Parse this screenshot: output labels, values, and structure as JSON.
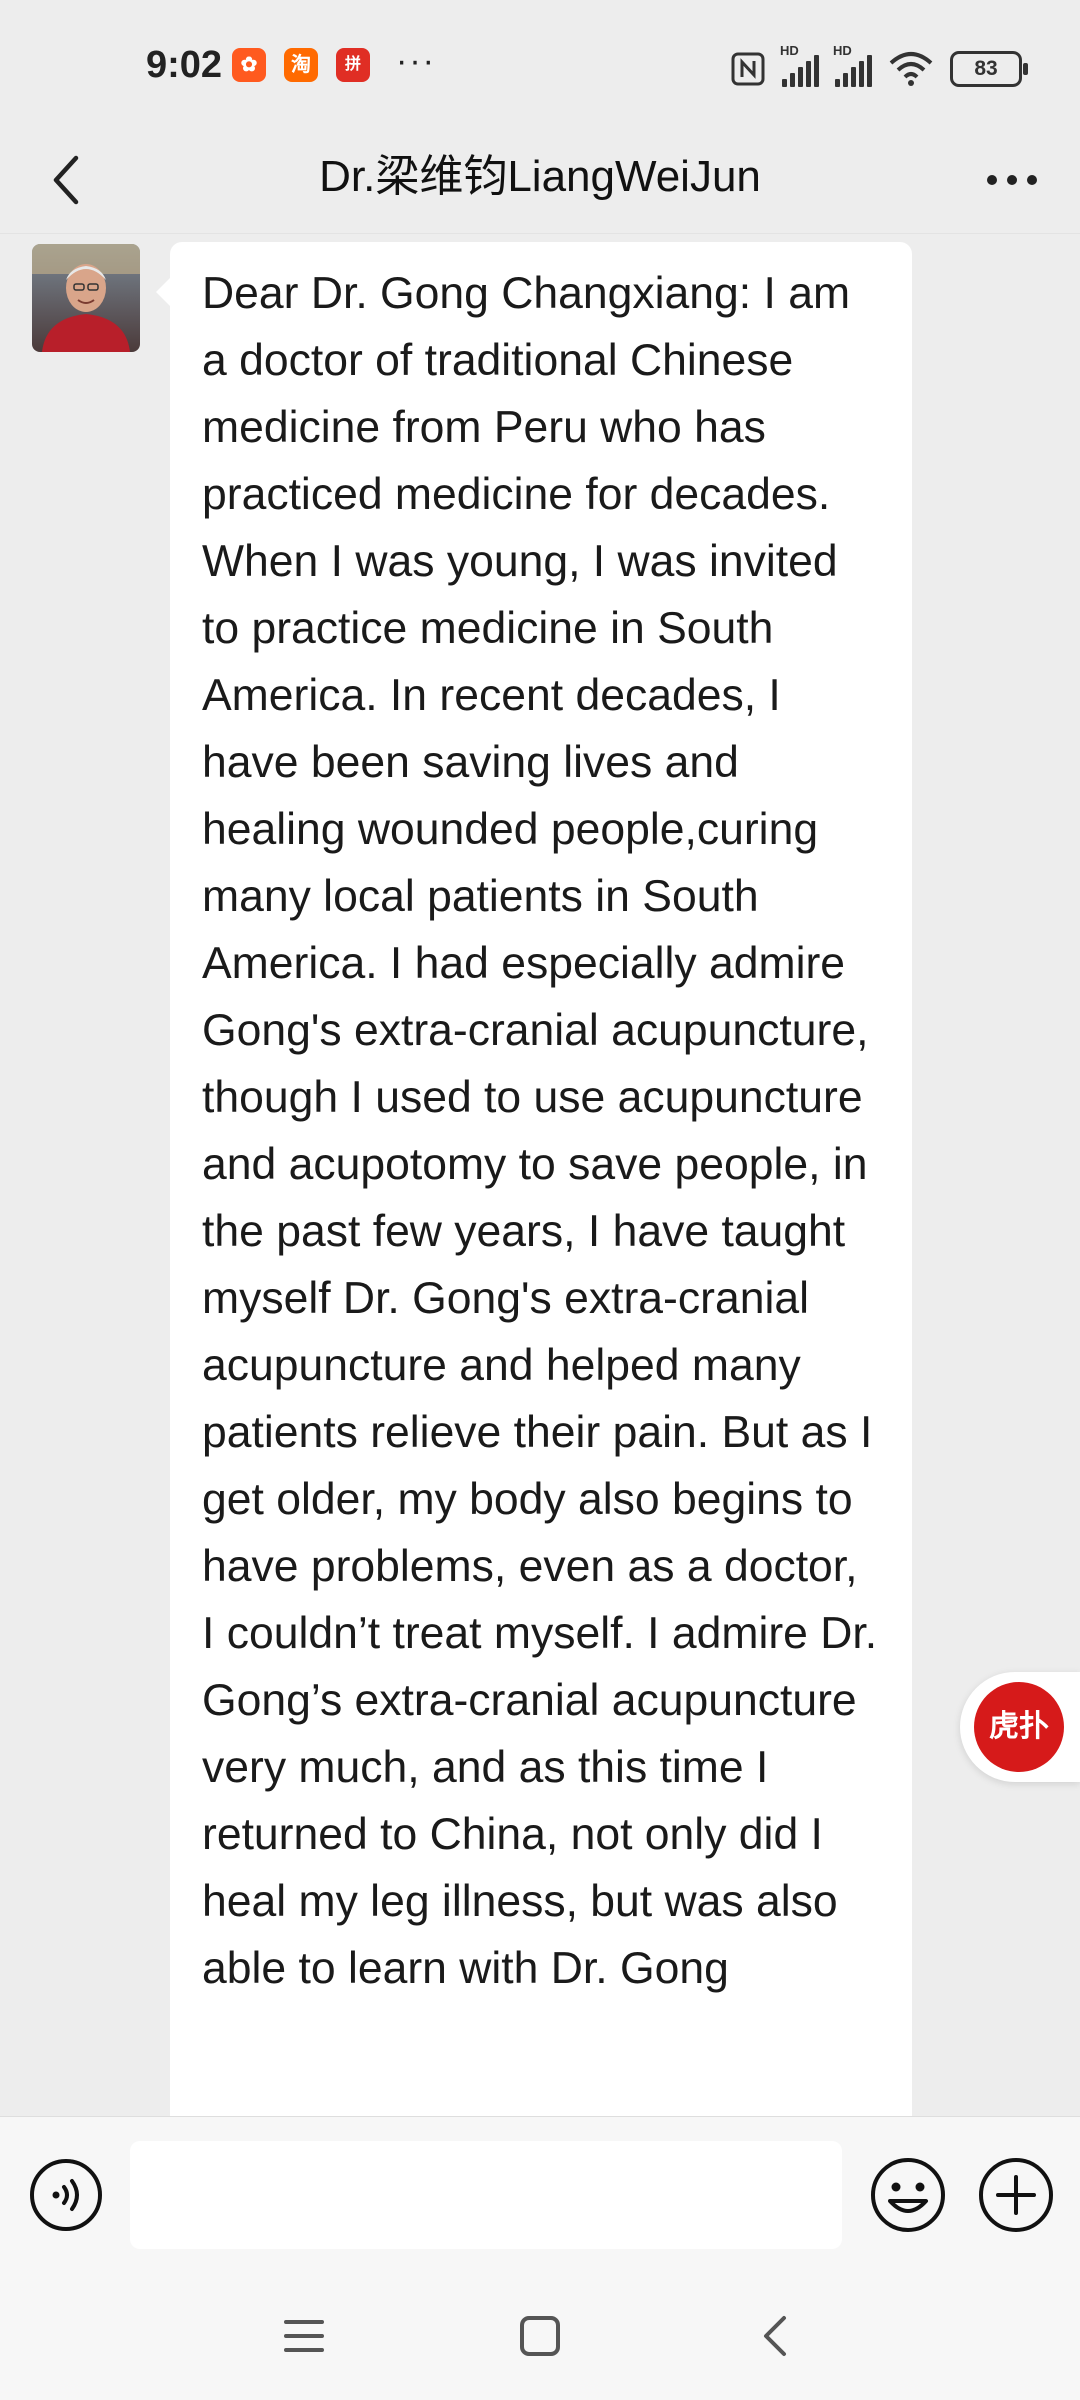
{
  "status_bar": {
    "time": "9:02",
    "app_icons": [
      {
        "name": "kuaishou-icon",
        "glyph": "✿",
        "color": "#ff5a1f"
      },
      {
        "name": "taobao-icon",
        "glyph": "淘",
        "color": "#ff6a00"
      },
      {
        "name": "pinduoduo-icon",
        "glyph": "拼",
        "color": "#e02e24"
      }
    ],
    "more_dots": "···",
    "network_tag": "HD",
    "battery": "83"
  },
  "header": {
    "title": "Dr.梁维钧LiangWeiJun"
  },
  "message": {
    "text": "Dear Dr. Gong Changxiang: I am a doctor of traditional Chinese medicine from Peru who has practiced medicine for decades. When I was young, I was invited to practice medicine in South America. In recent decades, I have been saving lives and healing wounded people,curing many local patients in South America. I had especially admire Gong's extra-cranial acupuncture, though I used to use acupuncture and acupotomy to save people, in the past few years, I have taught myself Dr. Gong's extra-cranial acupuncture and helped many patients relieve their pain. But as I get older, my body also begins to have problems, even as a doctor, I couldn’t treat myself. I admire Dr. Gong’s extra-cranial acupuncture very much, and as this time I returned to China, not only did I heal my leg illness, but was also able to learn with Dr. Gong"
  },
  "floating_badge": {
    "glyph": "虎扑"
  },
  "input": {
    "value": "",
    "placeholder": ""
  },
  "colors": {
    "bubble": "#ffffff",
    "background": "#ededed",
    "badge_red": "#d61a1a"
  }
}
